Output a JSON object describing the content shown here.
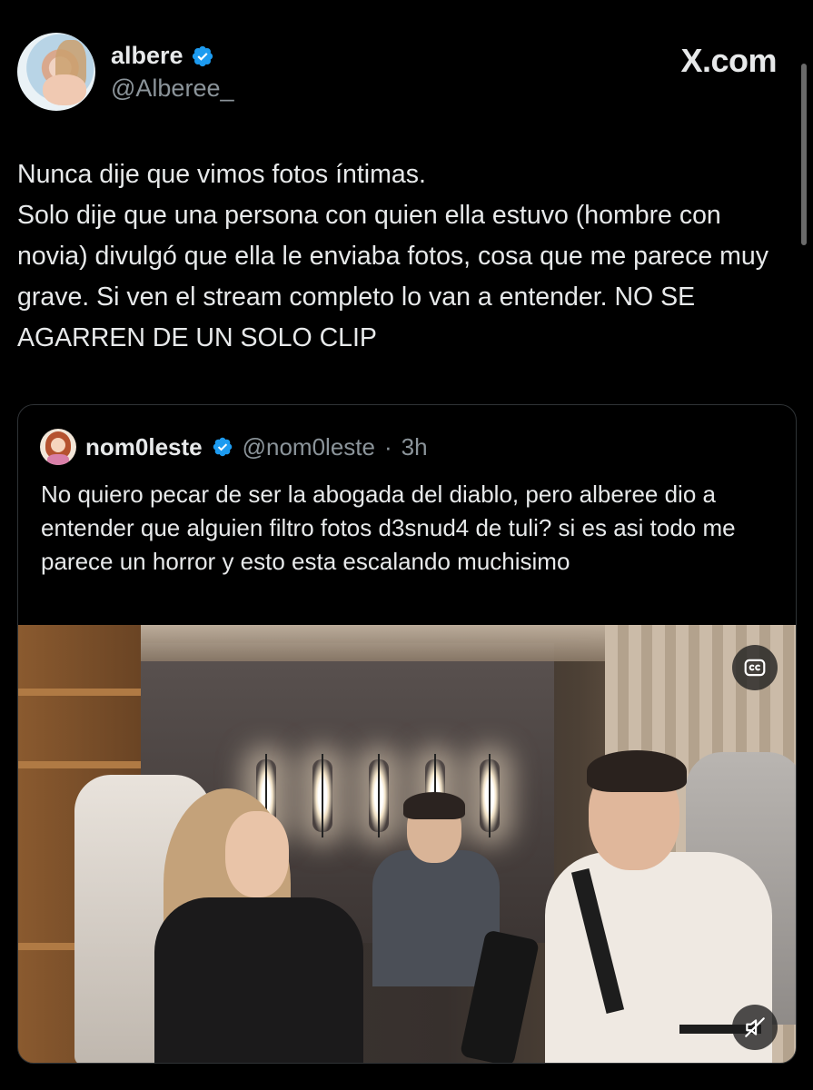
{
  "tweet": {
    "author": {
      "name": "albere",
      "handle": "@Alberee_",
      "verified": true
    },
    "site_logo": "X.com",
    "text": "Nunca dije que vimos fotos íntimas.\nSolo dije que una persona con quien ella estuvo (hombre con novia) divulgó que ella le enviaba fotos, cosa que me parece muy grave. Si ven el stream completo lo van a entender. NO SE AGARREN DE UN SOLO CLIP"
  },
  "quoted_tweet": {
    "author": {
      "name": "nom0leste",
      "handle": "@nom0leste",
      "verified": true
    },
    "separator": "·",
    "time": "3h",
    "text": "No quiero pecar de ser la abogada del diablo, pero alberee dio a entender que alguien filtro fotos d3snud4 de tuli? si es asi todo me parece un horror y esto esta escalando muchisimo",
    "media": {
      "type": "video",
      "controls": [
        "cc-icon",
        "mute-icon"
      ]
    }
  },
  "colors": {
    "background": "#000000",
    "text": "#e7e9ea",
    "secondary_text": "#8b949a",
    "verified_blue": "#1d9bf0",
    "border": "#2f3336"
  }
}
